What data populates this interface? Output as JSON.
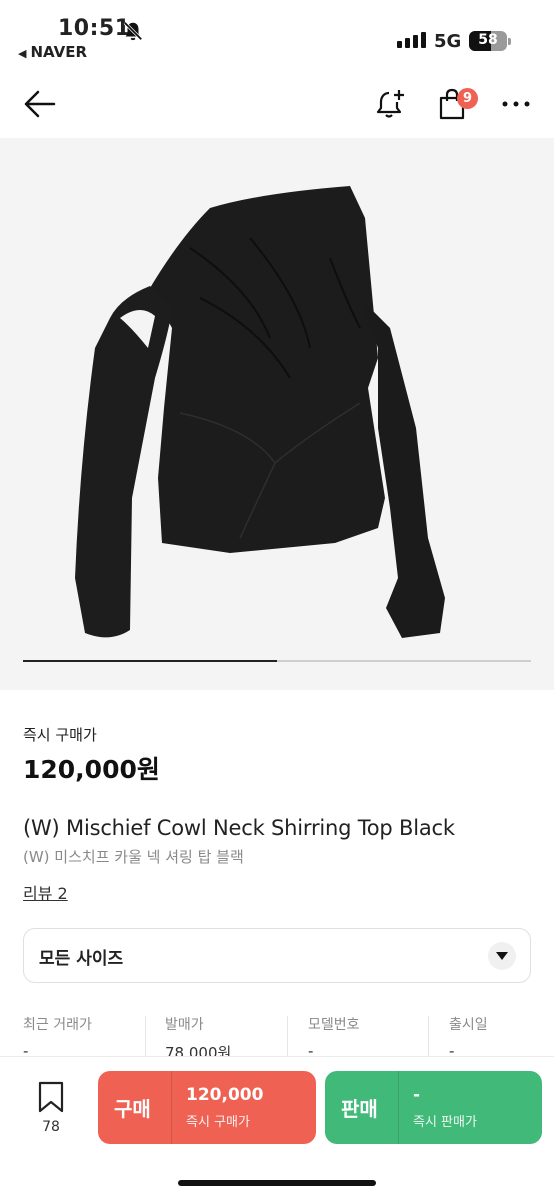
{
  "status_bar": {
    "time": "10:51",
    "back_to_app": "NAVER",
    "network": "5G",
    "battery": "58"
  },
  "header": {
    "cart_badge": "9"
  },
  "carousel": {
    "progress": 0.5
  },
  "product": {
    "price_label": "즉시 구매가",
    "price": "120,000원",
    "title_en": "(W) Mischief Cowl Neck Shirring Top Black",
    "title_kr": "(W) 미스치프 카울 넥 셔링 탑 블랙",
    "review_link": "리뷰 2",
    "size_select": "모든 사이즈"
  },
  "info": [
    {
      "key": "최근 거래가",
      "value": "-"
    },
    {
      "key": "발매가",
      "value": "78,000원"
    },
    {
      "key": "모델번호",
      "value": "-"
    },
    {
      "key": "출시일",
      "value": "-"
    }
  ],
  "bottom_bar": {
    "bookmark_count": "78",
    "buy": {
      "label": "구매",
      "price": "120,000",
      "sub": "즉시 구매가"
    },
    "sell": {
      "label": "판매",
      "price": "-",
      "sub": "즉시 판매가"
    }
  },
  "colors": {
    "buy": "#ef6253",
    "sell": "#41b979",
    "badge": "#ef6253"
  }
}
